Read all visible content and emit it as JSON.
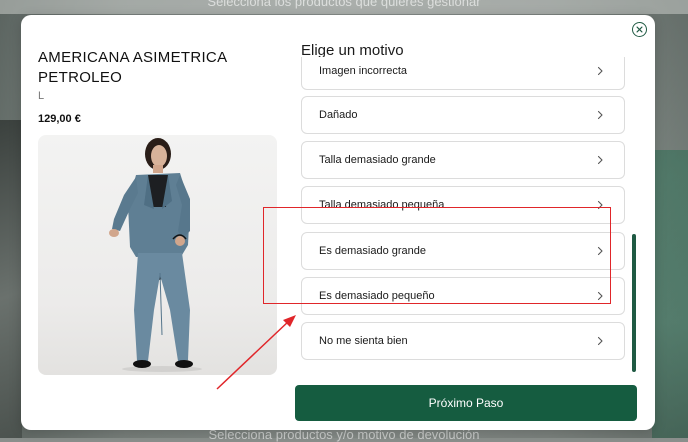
{
  "background": {
    "top_text": "Selecciona los productos que quieres gestionar",
    "bottom_text": "Selecciona productos y/o motivo de devolución"
  },
  "modal": {
    "close_icon": "close-circle-icon",
    "product": {
      "name": "AMERICANA ASIMETRICA PETROLEO",
      "size": "L",
      "price": "129,00 €",
      "image": "product-photo-suit"
    },
    "reasons_title": "Elige un motivo",
    "reasons": [
      {
        "label": "Imagen incorrecta"
      },
      {
        "label": "Dañado"
      },
      {
        "label": "Talla demasiado grande"
      },
      {
        "label": "Talla demasiado pequeña"
      },
      {
        "label": "Es demasiado grande"
      },
      {
        "label": "Es demasiado pequeño"
      },
      {
        "label": "No me sienta bien"
      }
    ],
    "next_button": "Próximo Paso"
  },
  "colors": {
    "brand_green": "#155c40",
    "highlight_red": "#e0262a",
    "border": "#dcdcdc"
  }
}
